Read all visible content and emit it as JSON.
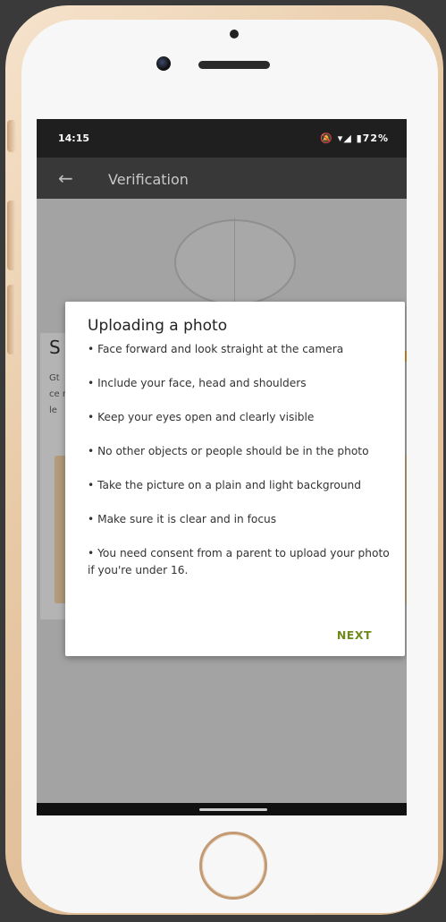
{
  "status_bar": {
    "time": "14:15",
    "icons": "🔕 ▾◢ ▮72%"
  },
  "app_bar": {
    "back_icon": "←",
    "title": "Verification"
  },
  "background": {
    "heading_partial": "S",
    "text_fragments": "Gt ce re le"
  },
  "dialog": {
    "title": "Uploading a photo",
    "items": [
      "• Face forward and look straight at the camera",
      "• Include your face, head and shoulders",
      "• Keep your eyes open and clearly visible",
      "• No other objects or people should be in the photo",
      "• Take the picture on a plain and light background",
      "• Make sure it is clear and in focus",
      "• You need consent from a parent to upload your photo if you're under 16."
    ],
    "next_label": "NEXT"
  },
  "colors": {
    "accent_next": "#6d8a1a",
    "app_bar": "#383838",
    "status_bar": "#1f1f1f"
  }
}
